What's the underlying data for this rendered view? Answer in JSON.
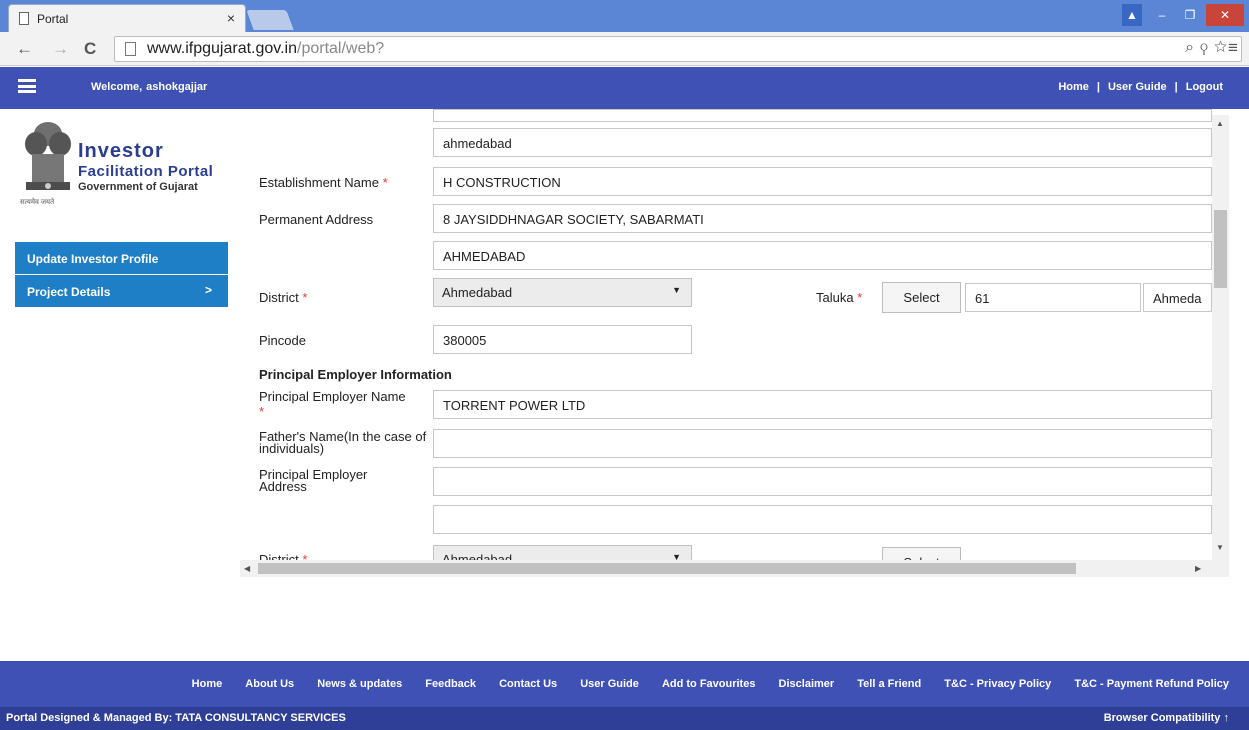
{
  "browser": {
    "tab_title": "Portal",
    "tab_close": "×",
    "url_host": "www.ifpgujarat.gov.in",
    "url_path": "/portal/web?"
  },
  "header": {
    "welcome_label": "Welcome,",
    "username": "ashokgajjar",
    "links": [
      "Home",
      "User Guide",
      "Logout"
    ],
    "separator": "|"
  },
  "logo": {
    "line1": "Investor",
    "line2": "Facilitation Portal",
    "line3": "Government of Gujarat",
    "motto": "सत्यमेव जयते"
  },
  "sidebar": {
    "items": [
      {
        "label": "Update Investor Profile"
      },
      {
        "label": "Project Details",
        "arrow": ">"
      }
    ]
  },
  "form": {
    "top_partial_value": "",
    "city_value": "ahmedabad",
    "establishment_label": "Establishment Name",
    "establishment_value": "H CONSTRUCTION",
    "permanent_address_label": "Permanent Address",
    "address_line1": "8 JAYSIDDHNAGAR SOCIETY, SABARMATI",
    "address_line2": "AHMEDABAD",
    "district_label": "District",
    "district_value": "Ahmedabad",
    "taluka_label": "Taluka",
    "select_label": "Select",
    "taluka_code": "61",
    "taluka_name": "Ahmeda",
    "pincode_label": "Pincode",
    "pincode_value": "380005",
    "section_title": "Principal Employer Information",
    "pe_name_label": "Principal Employer Name",
    "pe_name_value": "TORRENT POWER LTD",
    "father_label": "Father's Name(In the case of individuals)",
    "father_value": "",
    "pe_address_label": "Principal Employer Address",
    "pe_address1": "",
    "pe_address2": "",
    "district2_label": "District",
    "district2_value": "Ahmedabad",
    "required_mark": "*"
  },
  "footer": {
    "links": [
      "Home",
      "About Us",
      "News & updates",
      "Feedback",
      "Contact Us",
      "User Guide",
      "Add to Favourites",
      "Disclaimer",
      "Tell a Friend",
      "T&C - Privacy Policy",
      "T&C - Payment Refund Policy"
    ],
    "credit": "Portal Designed & Managed By: TATA CONSULTANCY SERVICES",
    "compat": "Browser Compatibility"
  }
}
